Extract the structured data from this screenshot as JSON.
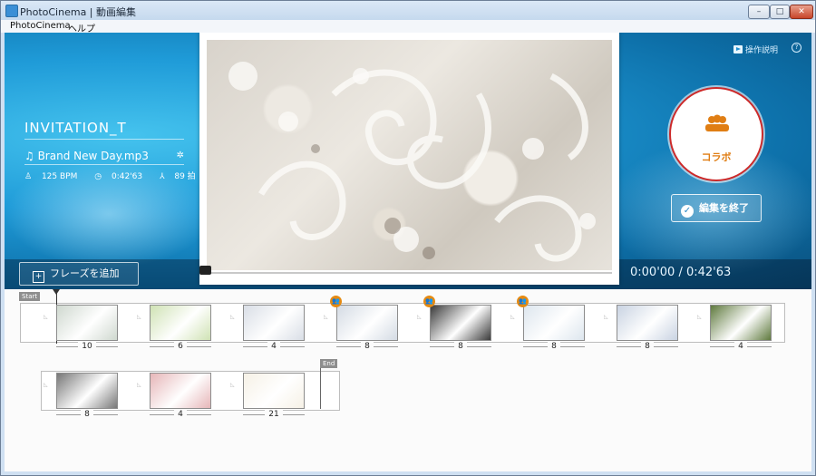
{
  "window": {
    "title": "PhotoCinema | 動画編集",
    "controls": {
      "minimize": "–",
      "maximize": "□",
      "close": "✕"
    }
  },
  "menu": {
    "items": [
      "PhotoCinema",
      "ヘルプ"
    ]
  },
  "header": {
    "help_label": "操作説明",
    "help_icon": "?"
  },
  "project": {
    "title": "INVITATION_T",
    "music": "Brand New Day.mp3",
    "bpm": "125 BPM",
    "duration": "0:42'63",
    "beats": "89 拍"
  },
  "buttons": {
    "add_phrase": "フレーズを追加",
    "collab": "コラボ",
    "finish": "編集を終了"
  },
  "player": {
    "timecode": "0:00'00 / 0:42'63",
    "progress": 0
  },
  "timeline": {
    "start_label": "Start",
    "end_label": "End",
    "row1": [
      {
        "count": "10",
        "tone": "#cfd8cf",
        "collab": false
      },
      {
        "count": "6",
        "tone": "#cfe2b4",
        "collab": false
      },
      {
        "count": "4",
        "tone": "#d9dee6",
        "collab": false
      },
      {
        "count": "8",
        "tone": "#d4dbe4",
        "collab": true
      },
      {
        "count": "8",
        "tone": "#3a3a3a",
        "collab": true
      },
      {
        "count": "8",
        "tone": "#dde6ee",
        "collab": true
      },
      {
        "count": "8",
        "tone": "#c9d3e2",
        "collab": false
      },
      {
        "count": "4",
        "tone": "#5f7a3e",
        "collab": false
      }
    ],
    "row2": [
      {
        "count": "8",
        "tone": "#777777",
        "collab": false
      },
      {
        "count": "4",
        "tone": "#e6b6b8",
        "collab": false
      },
      {
        "count": "21",
        "tone": "#f6f1e6",
        "collab": false
      }
    ]
  }
}
